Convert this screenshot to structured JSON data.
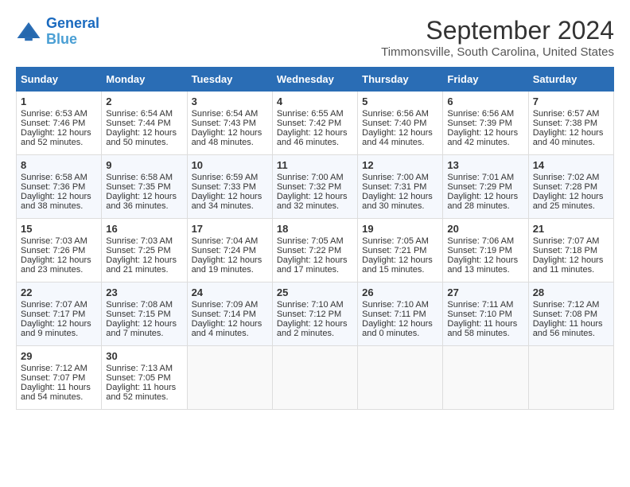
{
  "logo": {
    "line1": "General",
    "line2": "Blue"
  },
  "title": "September 2024",
  "subtitle": "Timmonsville, South Carolina, United States",
  "days_of_week": [
    "Sunday",
    "Monday",
    "Tuesday",
    "Wednesday",
    "Thursday",
    "Friday",
    "Saturday"
  ],
  "weeks": [
    [
      {
        "day": "1",
        "sunrise": "6:53 AM",
        "sunset": "7:46 PM",
        "daylight": "12 hours and 52 minutes."
      },
      {
        "day": "2",
        "sunrise": "6:54 AM",
        "sunset": "7:44 PM",
        "daylight": "12 hours and 50 minutes."
      },
      {
        "day": "3",
        "sunrise": "6:54 AM",
        "sunset": "7:43 PM",
        "daylight": "12 hours and 48 minutes."
      },
      {
        "day": "4",
        "sunrise": "6:55 AM",
        "sunset": "7:42 PM",
        "daylight": "12 hours and 46 minutes."
      },
      {
        "day": "5",
        "sunrise": "6:56 AM",
        "sunset": "7:40 PM",
        "daylight": "12 hours and 44 minutes."
      },
      {
        "day": "6",
        "sunrise": "6:56 AM",
        "sunset": "7:39 PM",
        "daylight": "12 hours and 42 minutes."
      },
      {
        "day": "7",
        "sunrise": "6:57 AM",
        "sunset": "7:38 PM",
        "daylight": "12 hours and 40 minutes."
      }
    ],
    [
      {
        "day": "8",
        "sunrise": "6:58 AM",
        "sunset": "7:36 PM",
        "daylight": "12 hours and 38 minutes."
      },
      {
        "day": "9",
        "sunrise": "6:58 AM",
        "sunset": "7:35 PM",
        "daylight": "12 hours and 36 minutes."
      },
      {
        "day": "10",
        "sunrise": "6:59 AM",
        "sunset": "7:33 PM",
        "daylight": "12 hours and 34 minutes."
      },
      {
        "day": "11",
        "sunrise": "7:00 AM",
        "sunset": "7:32 PM",
        "daylight": "12 hours and 32 minutes."
      },
      {
        "day": "12",
        "sunrise": "7:00 AM",
        "sunset": "7:31 PM",
        "daylight": "12 hours and 30 minutes."
      },
      {
        "day": "13",
        "sunrise": "7:01 AM",
        "sunset": "7:29 PM",
        "daylight": "12 hours and 28 minutes."
      },
      {
        "day": "14",
        "sunrise": "7:02 AM",
        "sunset": "7:28 PM",
        "daylight": "12 hours and 25 minutes."
      }
    ],
    [
      {
        "day": "15",
        "sunrise": "7:03 AM",
        "sunset": "7:26 PM",
        "daylight": "12 hours and 23 minutes."
      },
      {
        "day": "16",
        "sunrise": "7:03 AM",
        "sunset": "7:25 PM",
        "daylight": "12 hours and 21 minutes."
      },
      {
        "day": "17",
        "sunrise": "7:04 AM",
        "sunset": "7:24 PM",
        "daylight": "12 hours and 19 minutes."
      },
      {
        "day": "18",
        "sunrise": "7:05 AM",
        "sunset": "7:22 PM",
        "daylight": "12 hours and 17 minutes."
      },
      {
        "day": "19",
        "sunrise": "7:05 AM",
        "sunset": "7:21 PM",
        "daylight": "12 hours and 15 minutes."
      },
      {
        "day": "20",
        "sunrise": "7:06 AM",
        "sunset": "7:19 PM",
        "daylight": "12 hours and 13 minutes."
      },
      {
        "day": "21",
        "sunrise": "7:07 AM",
        "sunset": "7:18 PM",
        "daylight": "12 hours and 11 minutes."
      }
    ],
    [
      {
        "day": "22",
        "sunrise": "7:07 AM",
        "sunset": "7:17 PM",
        "daylight": "12 hours and 9 minutes."
      },
      {
        "day": "23",
        "sunrise": "7:08 AM",
        "sunset": "7:15 PM",
        "daylight": "12 hours and 7 minutes."
      },
      {
        "day": "24",
        "sunrise": "7:09 AM",
        "sunset": "7:14 PM",
        "daylight": "12 hours and 4 minutes."
      },
      {
        "day": "25",
        "sunrise": "7:10 AM",
        "sunset": "7:12 PM",
        "daylight": "12 hours and 2 minutes."
      },
      {
        "day": "26",
        "sunrise": "7:10 AM",
        "sunset": "7:11 PM",
        "daylight": "12 hours and 0 minutes."
      },
      {
        "day": "27",
        "sunrise": "7:11 AM",
        "sunset": "7:10 PM",
        "daylight": "11 hours and 58 minutes."
      },
      {
        "day": "28",
        "sunrise": "7:12 AM",
        "sunset": "7:08 PM",
        "daylight": "11 hours and 56 minutes."
      }
    ],
    [
      {
        "day": "29",
        "sunrise": "7:12 AM",
        "sunset": "7:07 PM",
        "daylight": "11 hours and 54 minutes."
      },
      {
        "day": "30",
        "sunrise": "7:13 AM",
        "sunset": "7:05 PM",
        "daylight": "11 hours and 52 minutes."
      },
      null,
      null,
      null,
      null,
      null
    ]
  ],
  "labels": {
    "sunrise": "Sunrise:",
    "sunset": "Sunset:",
    "daylight": "Daylight:"
  }
}
